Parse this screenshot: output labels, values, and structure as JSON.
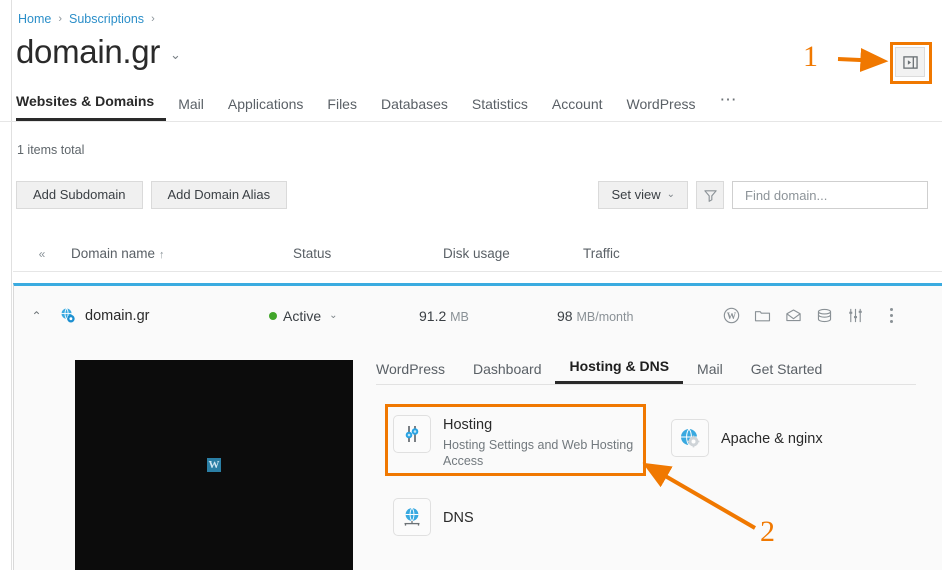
{
  "breadcrumb": {
    "items": [
      {
        "label": "Home",
        "name": "breadcrumb-home"
      },
      {
        "label": "Subscriptions",
        "name": "breadcrumb-subscriptions"
      }
    ],
    "separator": "›",
    "trailing_separator": "›"
  },
  "header": {
    "title": "domain.gr",
    "title_caret": "⌄",
    "collapse_panel_icon": "panel-collapse-icon"
  },
  "main_tabs": [
    {
      "label": "Websites & Domains",
      "active": true
    },
    {
      "label": "Mail",
      "active": false
    },
    {
      "label": "Applications",
      "active": false
    },
    {
      "label": "Files",
      "active": false
    },
    {
      "label": "Databases",
      "active": false
    },
    {
      "label": "Statistics",
      "active": false
    },
    {
      "label": "Account",
      "active": false
    },
    {
      "label": "WordPress",
      "active": false
    }
  ],
  "main_tabs_more": "⋯",
  "list": {
    "items_total": "1 items total"
  },
  "toolbar": {
    "add_subdomain": "Add Subdomain",
    "add_domain_alias": "Add Domain Alias",
    "set_view": "Set view",
    "set_view_caret": "⌄",
    "filter_icon": "filter-funnel-icon",
    "search_placeholder": "Find domain...",
    "search_value": "",
    "search_icon": "search-icon"
  },
  "table": {
    "collapse_all_icon": "«",
    "columns": [
      {
        "label": "Domain name",
        "sort": "↑"
      },
      {
        "label": "Status",
        "sort": ""
      },
      {
        "label": "Disk usage",
        "sort": ""
      },
      {
        "label": "Traffic",
        "sort": ""
      }
    ],
    "row": {
      "expand_caret": "⌃",
      "domain_icon": "domain-globe-gear-icon",
      "domain_name": "domain.gr",
      "status": "Active",
      "status_caret": "⌄",
      "status_color": "#41a62a",
      "disk_usage_value": "91.2",
      "disk_usage_unit": "MB",
      "traffic_value": "98",
      "traffic_unit": "MB/month",
      "actions": [
        {
          "name": "wordpress-icon"
        },
        {
          "name": "folder-icon"
        },
        {
          "name": "mail-icon"
        },
        {
          "name": "database-icon"
        },
        {
          "name": "hosting-settings-icon"
        }
      ],
      "kebab_icon": "more-actions-icon"
    }
  },
  "detail": {
    "preview_badge": "W",
    "preview_label": "site-preview-thumbnail",
    "subtabs": [
      {
        "label": "WordPress",
        "active": false
      },
      {
        "label": "Dashboard",
        "active": false
      },
      {
        "label": "Hosting & DNS",
        "active": true
      },
      {
        "label": "Mail",
        "active": false
      },
      {
        "label": "Get Started",
        "active": false
      }
    ],
    "cards": [
      {
        "id": "hosting",
        "title": "Hosting",
        "subtitle": "Hosting Settings and Web Hosting Access",
        "icon": "hosting-sliders-icon",
        "highlighted": true
      },
      {
        "id": "apache",
        "title": "Apache & nginx",
        "subtitle": "",
        "icon": "apache-nginx-globe-gear-icon",
        "highlighted": false
      },
      {
        "id": "dns",
        "title": "DNS",
        "subtitle": "",
        "icon": "dns-globe-network-icon",
        "highlighted": false
      }
    ]
  },
  "annotations": {
    "accent_color": "#f07800",
    "step_1": "1",
    "step_2": "2"
  }
}
